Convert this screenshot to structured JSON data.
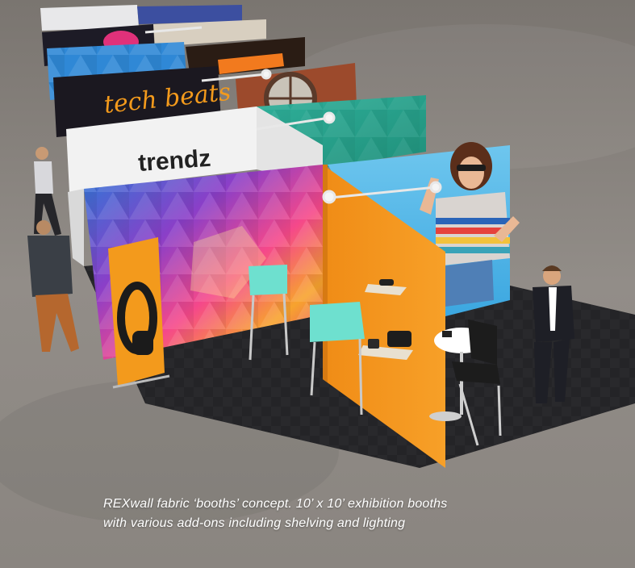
{
  "image": {
    "description_colors": {
      "accent_bar": "#b8a94a",
      "floor": "#8d8985",
      "carpet": "#2a2a2c",
      "orange": "#f39a1c",
      "teal": "#2aa88e",
      "stool_seat": "#6ee0cf"
    }
  },
  "signs": {
    "trendz": "trendz",
    "tech_beats": "tech beats"
  },
  "caption": {
    "line1": "REXwall fabric ‘booths’ concept. 10’ x 10’ exhibition booths",
    "line2": "with various add-ons including shelving and lighting"
  }
}
